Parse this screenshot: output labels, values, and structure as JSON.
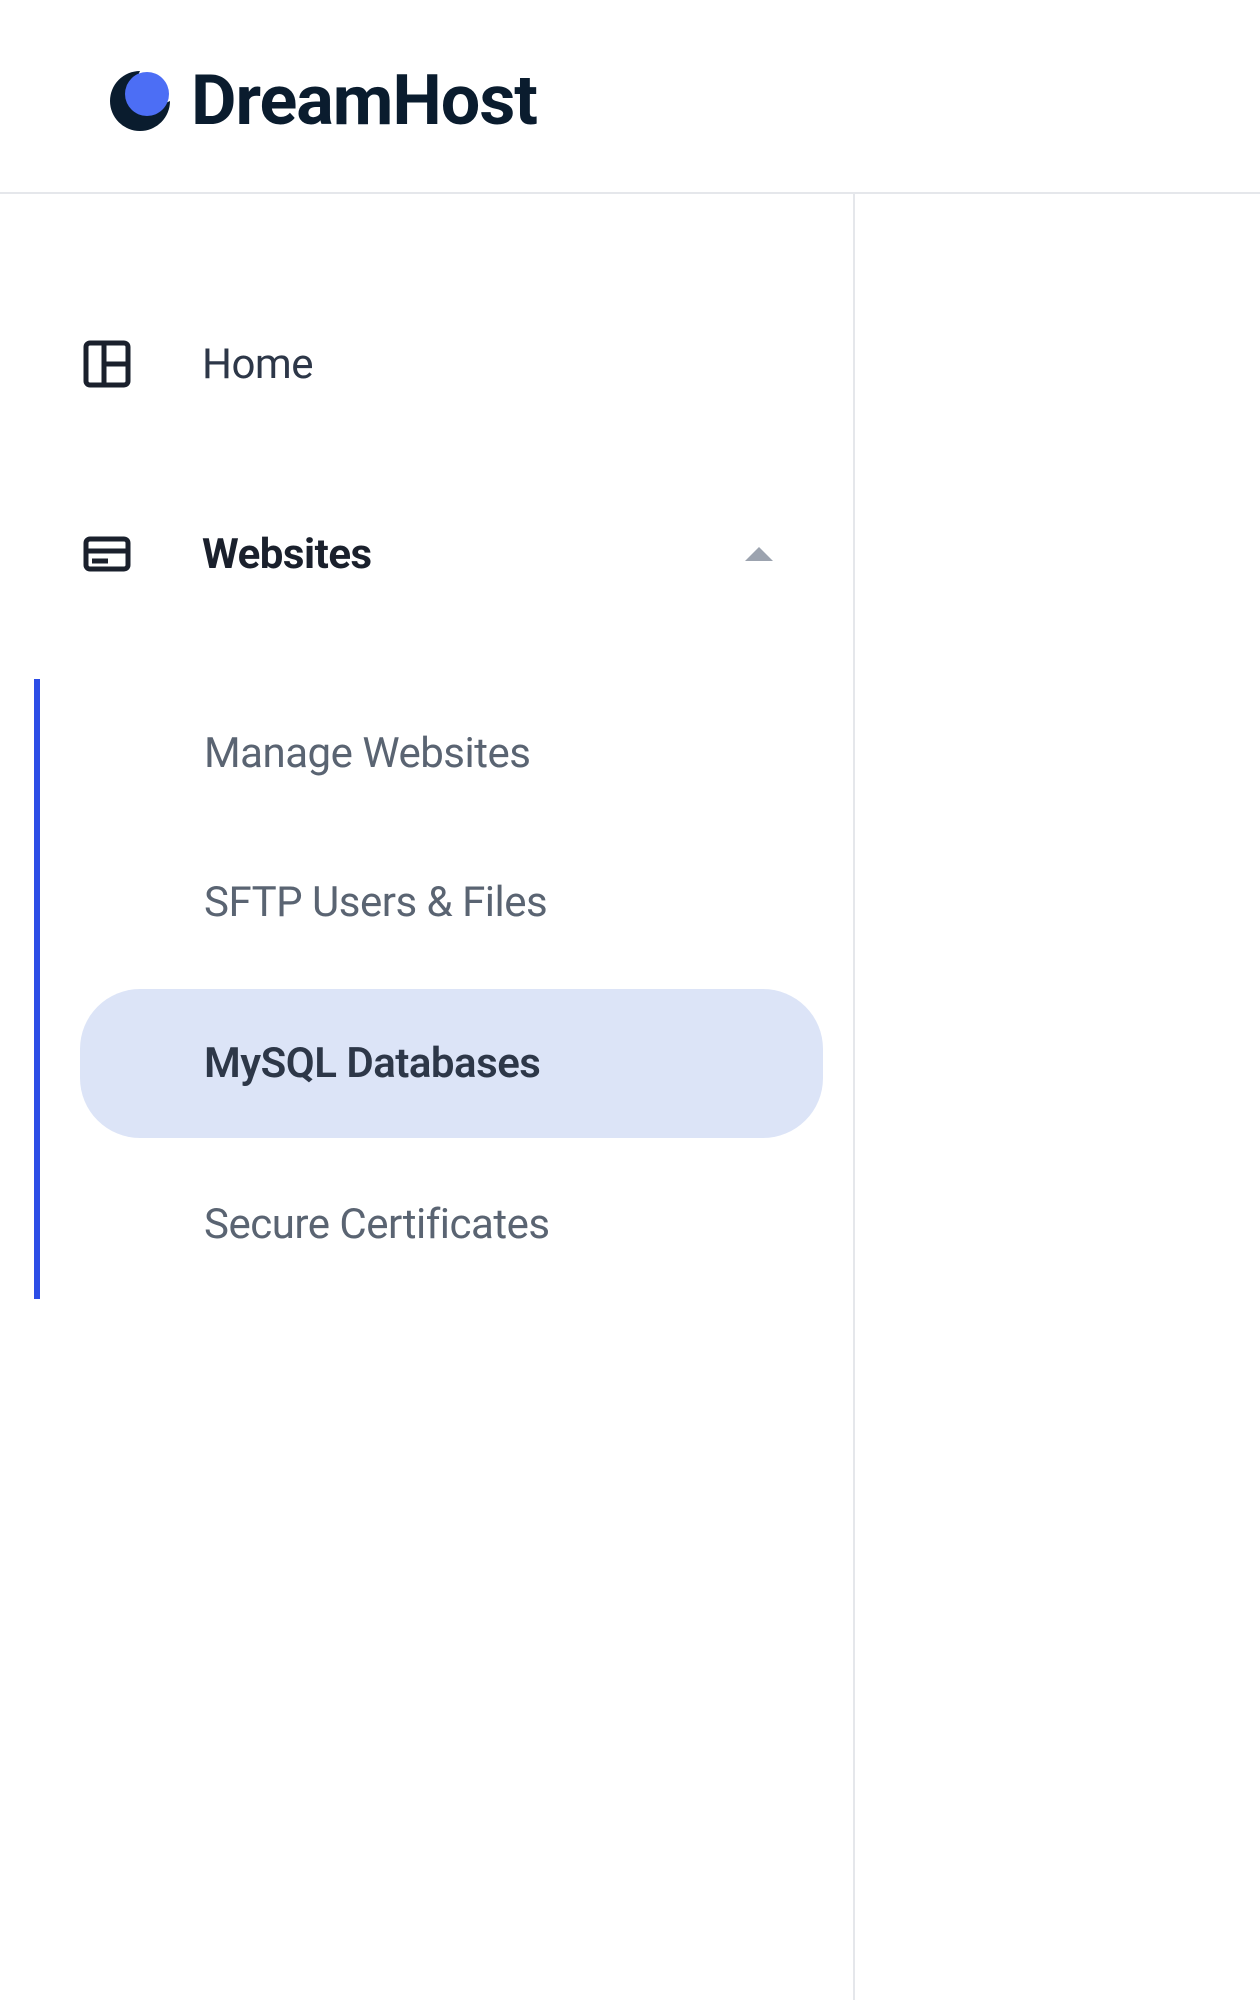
{
  "brand": {
    "name": "DreamHost"
  },
  "nav": {
    "home": {
      "label": "Home"
    },
    "websites": {
      "label": "Websites",
      "expanded": true,
      "items": [
        {
          "label": "Manage Websites",
          "active": false
        },
        {
          "label": "SFTP Users & Files",
          "active": false
        },
        {
          "label": "MySQL Databases",
          "active": true
        },
        {
          "label": "Secure Certificates",
          "active": false
        }
      ]
    }
  }
}
